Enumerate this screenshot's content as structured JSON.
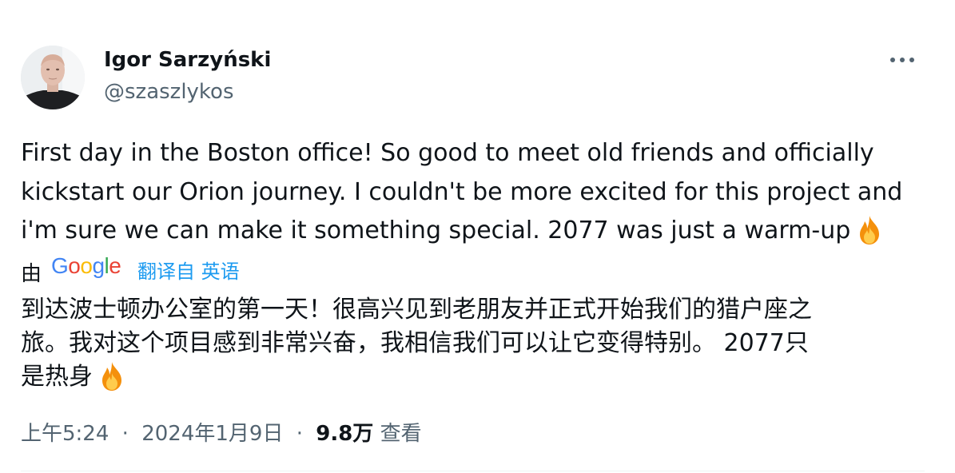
{
  "author": {
    "name": "Igor Sarzyński",
    "handle": "@szaszlykos"
  },
  "tweet": {
    "text_lines": [
      "First day in the Boston office! So good to meet old friends and officially",
      "kickstart our Orion journey. I couldn't be more excited for this project and",
      "i'm sure we can make it something special. 2077 was just a warm-up"
    ],
    "trailing_emoji": "fire-emoji"
  },
  "translation": {
    "prefix": "由",
    "provider": "Google",
    "link_label": "翻译自 英语",
    "text_lines": [
      "到达波士顿办公室的第一天！很高兴见到老朋友并正式开始我们的猎户座之",
      "旅。我对这个项目感到非常兴奋，我相信我们可以让它变得特别。 2077只",
      "是热身"
    ]
  },
  "meta": {
    "time": "上午5:24",
    "separator": "·",
    "date": "2024年1月9日",
    "views_count": "9.8万",
    "views_label": "查看"
  },
  "icons": {
    "more": "more-horizontal-icon"
  },
  "colors": {
    "text_primary": "#0f1419",
    "text_secondary": "#536471",
    "link": "#1d9bf0",
    "google_blue": "#4285F4",
    "google_red": "#EA4335",
    "google_yellow": "#FBBC05",
    "google_green": "#34A853"
  }
}
